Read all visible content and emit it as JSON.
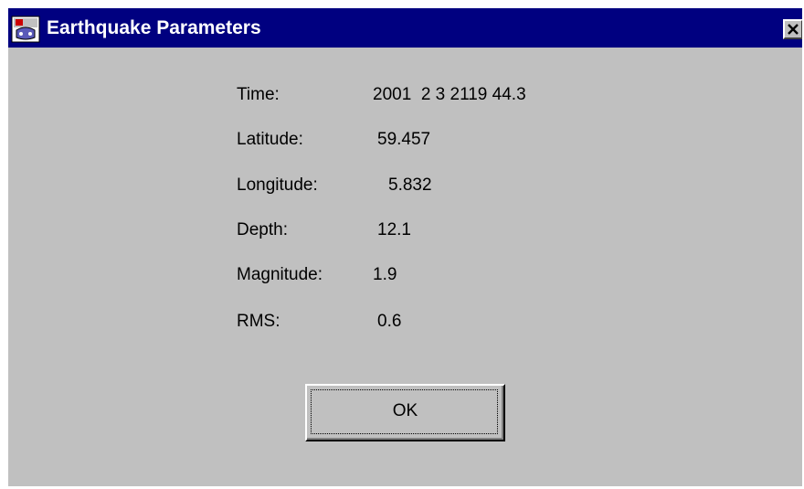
{
  "window": {
    "title": "Earthquake Parameters",
    "title_icon": "app-icon",
    "close_icon": "close-icon"
  },
  "fields": [
    {
      "label": "Time:",
      "value": "2001  2 3 2119 44.3"
    },
    {
      "label": "Latitude:",
      "value": "59.457"
    },
    {
      "label": "Longitude:",
      "value": "5.832"
    },
    {
      "label": "Depth:",
      "value": "12.1"
    },
    {
      "label": "Magnitude:",
      "value": "1.9"
    },
    {
      "label": "RMS:",
      "value": "0.6"
    }
  ],
  "buttons": {
    "ok_label": "OK"
  },
  "colors": {
    "titlebar": "#000080",
    "window_bg": "#c0c0c0",
    "title_text": "#ffffff"
  }
}
